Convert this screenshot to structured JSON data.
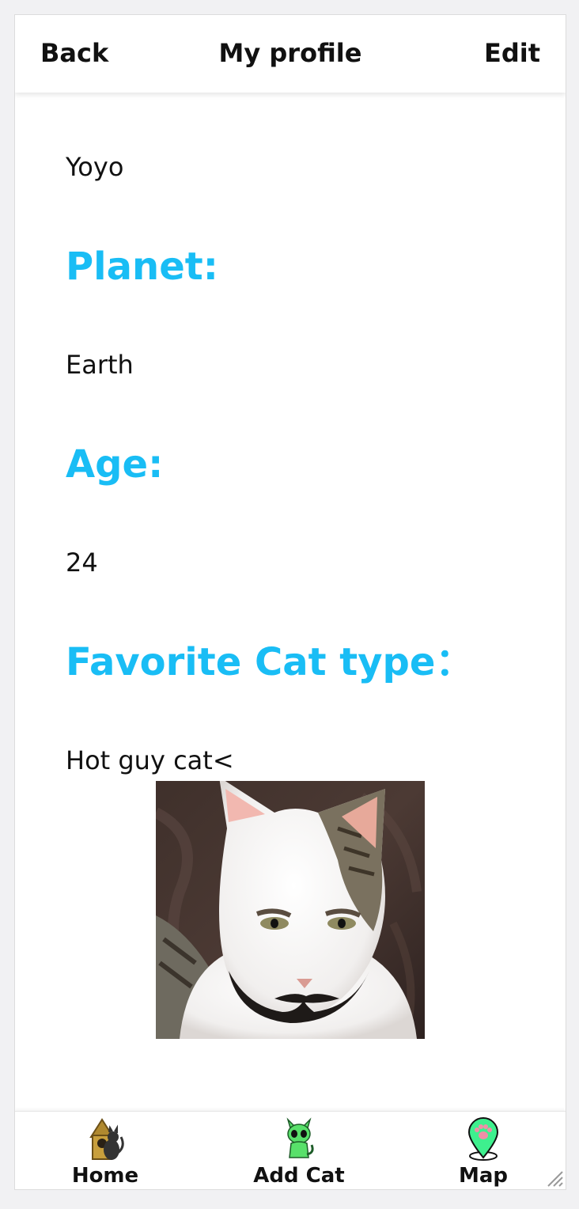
{
  "header": {
    "back_label": "Back",
    "title": "My profile",
    "edit_label": "Edit"
  },
  "profile": {
    "name": "Yoyo",
    "planet_heading": "Planet:",
    "planet": "Earth",
    "age_heading": "Age:",
    "age": "24",
    "cat_heading": "Favorite Cat type：",
    "cat_type": "Hot guy cat<"
  },
  "colors": {
    "accent": "#19bdf5",
    "map_pin": "#3ef08e",
    "alien_green": "#58e06a"
  },
  "nav": {
    "items": [
      {
        "label": "Home",
        "icon": "cat-house-icon"
      },
      {
        "label": "Add Cat",
        "icon": "alien-cat-icon"
      },
      {
        "label": "Map",
        "icon": "paw-map-pin-icon"
      }
    ]
  }
}
